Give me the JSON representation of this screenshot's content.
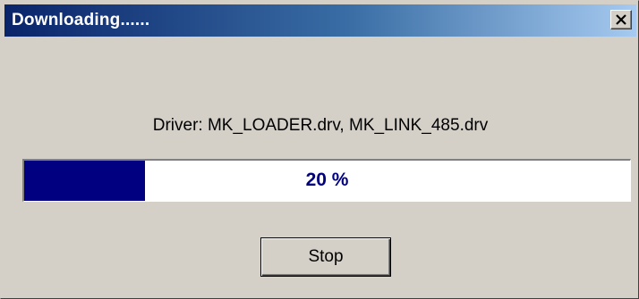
{
  "window": {
    "title": "Downloading......",
    "close_icon": "close-icon",
    "title_gradient_start": "#0a246a",
    "title_gradient_end": "#a6caf0",
    "background": "#d4d0c8"
  },
  "dialog": {
    "driver_label": "Driver: MK_LOADER.drv, MK_LINK_485.drv",
    "progress": {
      "fraction": 0.2,
      "text": "20 %",
      "fill_color": "#000080"
    },
    "stop_button_label": "Stop"
  }
}
